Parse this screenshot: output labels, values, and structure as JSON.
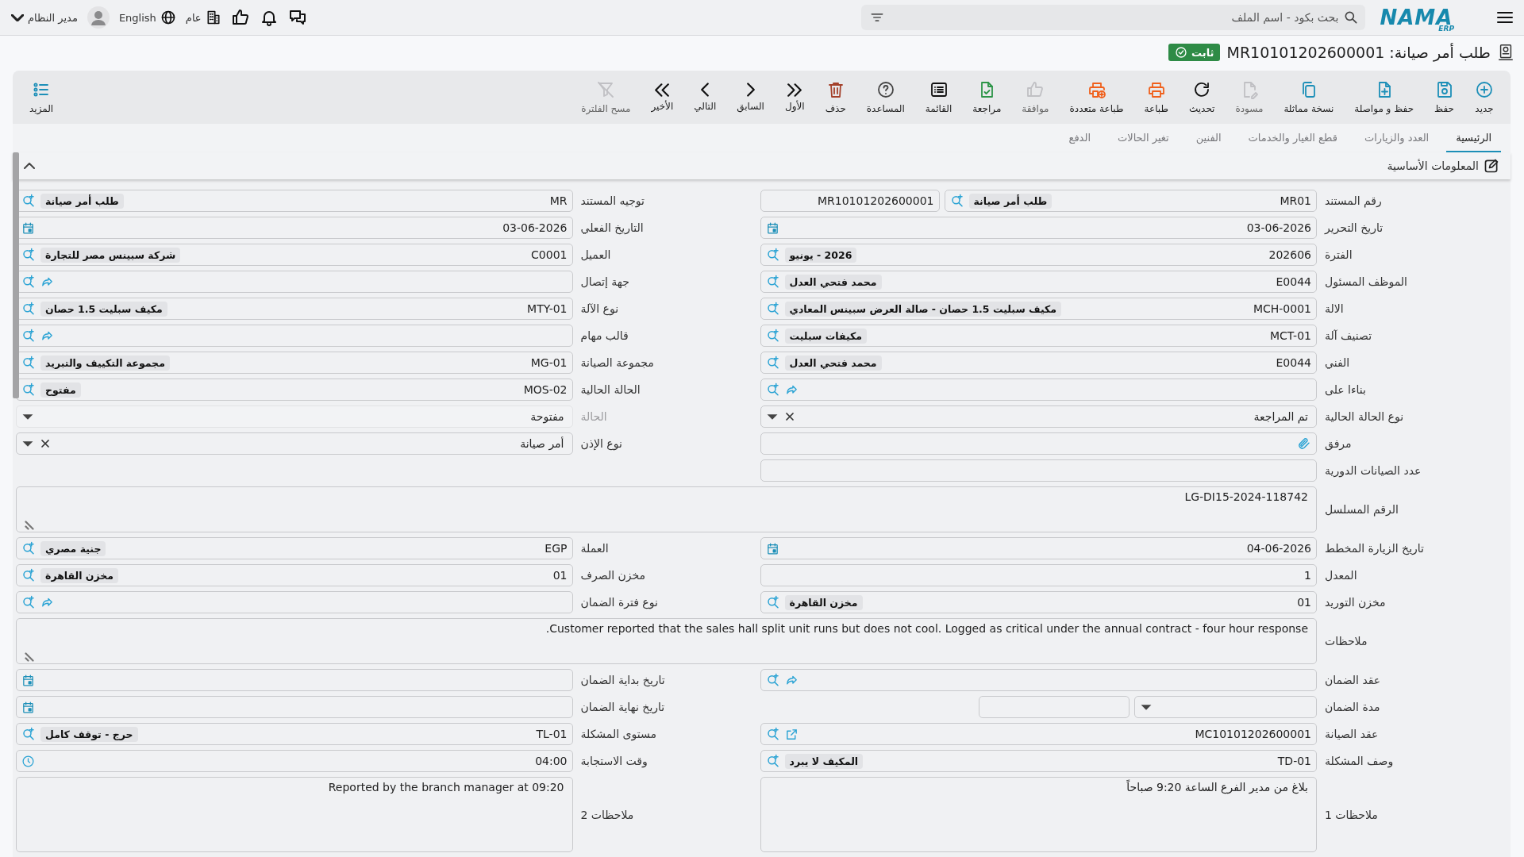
{
  "topbar": {
    "logo": {
      "text": "NAMA",
      "sub": "ERP"
    },
    "search": {
      "placeholder": "بحث بكود - اسم الملف"
    },
    "company": "عام",
    "language": "English",
    "user": "مدير النظام"
  },
  "title": {
    "text": "طلب أمر صيانة: MR10101202600001",
    "status": "ثابت"
  },
  "toolbar": [
    {
      "label": "جديد",
      "disabled": false
    },
    {
      "label": "حفظ",
      "disabled": false
    },
    {
      "label": "حفظ و مواصلة",
      "disabled": false
    },
    {
      "label": "نسخة مماثلة",
      "disabled": false
    },
    {
      "label": "مسودة",
      "disabled": true
    },
    {
      "label": "تحديث",
      "disabled": false
    },
    {
      "label": "طباعة",
      "disabled": false
    },
    {
      "label": "طباعة متعددة",
      "disabled": false
    },
    {
      "label": "موافقة",
      "disabled": true
    },
    {
      "label": "مراجعة",
      "disabled": false
    },
    {
      "label": "القائمة",
      "disabled": false
    },
    {
      "label": "المساعدة",
      "disabled": false
    },
    {
      "label": "حذف",
      "disabled": false
    },
    {
      "label": "الأول",
      "disabled": false
    },
    {
      "label": "السابق",
      "disabled": false
    },
    {
      "label": "التالي",
      "disabled": false
    },
    {
      "label": "الأخير",
      "disabled": false
    },
    {
      "label": "مسح الفلترة",
      "disabled": true
    }
  ],
  "more": {
    "label": "المزيد"
  },
  "tabs": [
    {
      "label": "الرئيسية",
      "selected": true
    },
    {
      "label": "العدد والزيارات",
      "selected": false
    },
    {
      "label": "قطع الغيار والخدمات",
      "selected": false
    },
    {
      "label": "الفنين",
      "selected": false
    },
    {
      "label": "تغير الحالات",
      "selected": false
    },
    {
      "label": "الدفع",
      "selected": false
    }
  ],
  "section": {
    "title": "المعلومات الأساسية",
    "expanded": true
  },
  "form_rows": [
    {
      "right": {
        "label": "رقم المستند",
        "kind": "doc_number",
        "code": "MR01",
        "name": "طلب أمر صيانة",
        "number": "MR10101202600001"
      },
      "left": {
        "label": "توجيه المستند",
        "kind": "lookup",
        "code": "MR",
        "name": "طلب أمر صيانة"
      }
    },
    {
      "right": {
        "label": "تاريخ التحرير",
        "kind": "date",
        "value": "03-06-2026"
      },
      "left": {
        "label": "التاريخ الفعلي",
        "kind": "date",
        "value": "03-06-2026"
      }
    },
    {
      "right": {
        "label": "الفترة",
        "kind": "lookup",
        "code": "202606",
        "name": "2026 - يونيو"
      },
      "left": {
        "label": "العميل",
        "kind": "lookup",
        "code": "C0001",
        "name": "شركة سبينس مصر للتجارة"
      }
    },
    {
      "right": {
        "label": "الموظف المسئول",
        "kind": "lookup",
        "code": "E0044",
        "name": "محمد فتحي العدل"
      },
      "left": {
        "label": "جهة إتصال",
        "kind": "lookup_link"
      }
    },
    {
      "right": {
        "label": "الالة",
        "kind": "lookup",
        "code": "MCH-0001",
        "name": "مكيف سبليت 1.5 حصان - صالة العرض سبينس المعادي"
      },
      "left": {
        "label": "نوع الآلة",
        "kind": "lookup",
        "code": "MTY-01",
        "name": "مكيف سبليت 1.5 حصان"
      }
    },
    {
      "right": {
        "label": "تصنيف آلة",
        "kind": "lookup",
        "code": "MCT-01",
        "name": "مكيفات سبليت"
      },
      "left": {
        "label": "قالب مهام",
        "kind": "lookup_link"
      }
    },
    {
      "right": {
        "label": "الفني",
        "kind": "lookup",
        "code": "E0044",
        "name": "محمد فتحي العدل"
      },
      "left": {
        "label": "مجموعة الصيانة",
        "kind": "lookup",
        "code": "MG-01",
        "name": "مجموعة التكييف والتبريد"
      }
    },
    {
      "right": {
        "label": "بناءا على",
        "kind": "lookup_link"
      },
      "left": {
        "label": "الحالة الحالية",
        "kind": "lookup",
        "code": "MOS-02",
        "name": "مفتوح"
      }
    },
    {
      "right": {
        "label": "نوع الحالة الحالية",
        "kind": "select",
        "value": "تم المراجعة",
        "clearable": true,
        "disabled": false
      },
      "left": {
        "label": "الحالة",
        "kind": "select",
        "value": "مفتوحة",
        "clearable": false,
        "disabled": true
      }
    },
    {
      "right": {
        "label": "مرفق",
        "kind": "attachment"
      },
      "left": {
        "label": "نوع الإذن",
        "kind": "select",
        "value": "أمر صيانة",
        "clearable": true,
        "disabled": false
      }
    },
    {
      "right": {
        "label": "عدد الصيانات الدورية",
        "kind": "text"
      }
    },
    {
      "wide": {
        "label": "الرقم المسلسل",
        "kind": "textarea",
        "value": "LG-DI15-2024-118742",
        "resizable": true
      }
    },
    {
      "right": {
        "label": "تاريخ الزيارة المخطط",
        "kind": "date",
        "value": "04-06-2026"
      },
      "left": {
        "label": "العملة",
        "kind": "lookup",
        "code": "EGP",
        "name": "جنية مصري"
      }
    },
    {
      "right": {
        "label": "المعدل",
        "kind": "text",
        "value": "1"
      },
      "left": {
        "label": "مخزن الصرف",
        "kind": "lookup",
        "code": "01",
        "name": "مخزن القاهرة"
      }
    },
    {
      "right": {
        "label": "مخزن التوريد",
        "kind": "lookup",
        "code": "01",
        "name": "مخزن القاهرة"
      },
      "left": {
        "label": "نوع فترة الضمان",
        "kind": "lookup_link"
      }
    },
    {
      "wide": {
        "label": "ملاحظات",
        "kind": "textarea",
        "value": "Customer reported that the sales hall split unit runs but does not cool. Logged as critical under the annual contract - four hour response.",
        "resizable": true
      }
    },
    {
      "right": {
        "label": "عقد الضمان",
        "kind": "lookup_link"
      },
      "left": {
        "label": "تاريخ بداية الضمان",
        "kind": "date"
      }
    },
    {
      "right": {
        "label": "مدة الضمان",
        "kind": "duration"
      },
      "left": {
        "label": "تاريخ نهاية الضمان",
        "kind": "date"
      }
    },
    {
      "right": {
        "label": "عقد الصيانة",
        "kind": "lookup_open",
        "code": "MC10101202600001"
      },
      "left": {
        "label": "مستوى المشكلة",
        "kind": "lookup",
        "code": "TL-01",
        "name": "حرج - توقف كامل"
      }
    },
    {
      "right": {
        "label": "وصف المشكلة",
        "kind": "lookup",
        "code": "TD-01",
        "name": "المكيف لا يبرد"
      },
      "left": {
        "label": "وقت الاستجابة",
        "kind": "time",
        "value": "04:00"
      }
    },
    {
      "right": {
        "label": "ملاحظات 1",
        "kind": "textarea",
        "value": "بلاغ من مدير الفرع الساعة 9:20 صباحاً",
        "resizable": false
      },
      "left": {
        "label": "ملاحظات 2",
        "kind": "textarea",
        "value": "Reported by the branch manager at 09:20",
        "resizable": false
      }
    }
  ]
}
